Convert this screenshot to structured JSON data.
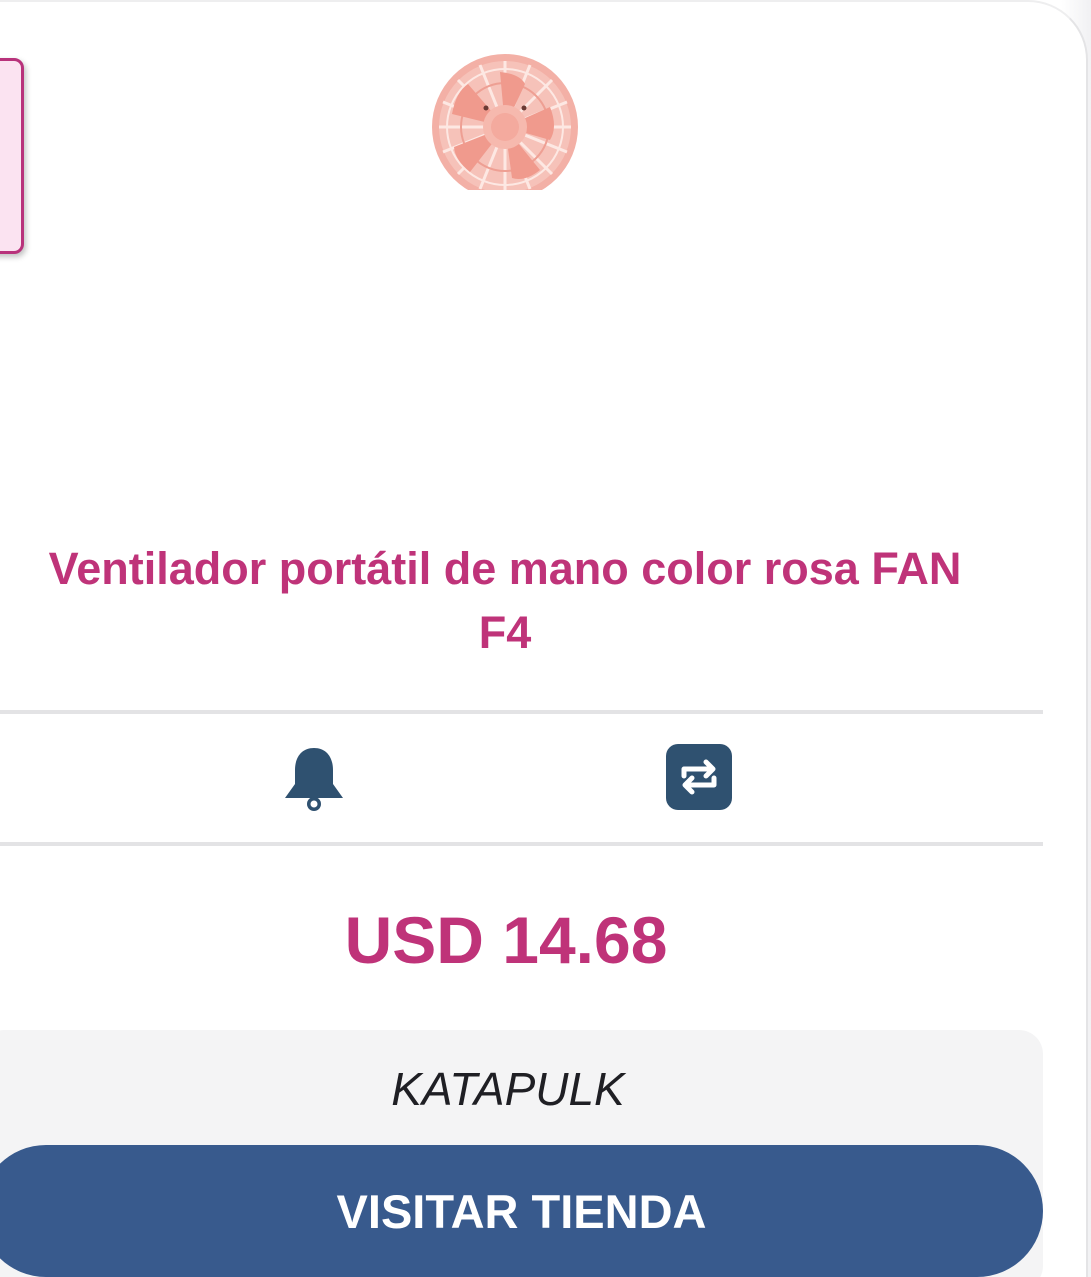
{
  "product": {
    "title": "Ventilador portátil de mano color rosa FAN F4",
    "image_icon": "pink-handheld-fan"
  },
  "actions": {
    "notify_icon": "bell-icon",
    "compare_icon": "compare-arrows-icon"
  },
  "price": {
    "label": "USD 14.68"
  },
  "store": {
    "name": "KATAPULK",
    "visit_label": "VISITAR TIENDA"
  },
  "colors": {
    "accent": "#bf3379",
    "icon": "#2f5170",
    "button": "#385a8d",
    "store_bg": "#f4f4f5"
  }
}
